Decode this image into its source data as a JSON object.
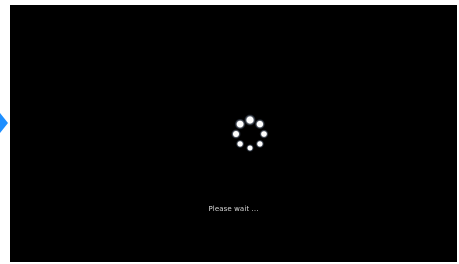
{
  "screen": {
    "status_text": "Please wait ...",
    "background_color": "#000000",
    "text_color": "#d9d9d9"
  },
  "icons": {
    "spinner": "loading-spinner-icon",
    "edge_arrow": "chevron-right-icon"
  },
  "colors": {
    "accent": "#1e8fff",
    "spinner_dot": "#ffffff"
  }
}
